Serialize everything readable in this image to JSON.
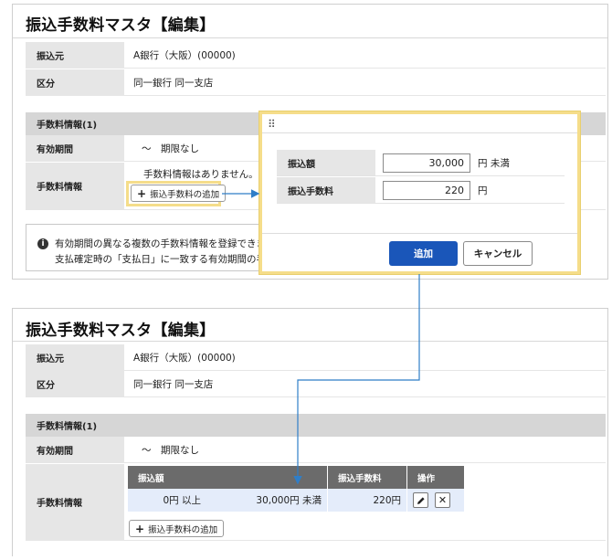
{
  "top": {
    "title": "振込手数料マスタ【編集】",
    "source_label": "振込元",
    "source_value": "A銀行（大阪）(00000)",
    "category_label": "区分",
    "category_value": "同一銀行 同一支店",
    "section_title": "手数料情報(1)",
    "period_label": "有効期間",
    "period_value": "～　期限なし",
    "fee_label": "手数料情報",
    "no_info": "手数料情報はありません。",
    "add_fee_button": "振込手数料の追加",
    "info_line1": "有効期間の異なる複数の手数料情報を登録できま",
    "info_line2": "支払確定時の「支払日」に一致する有効期間の手"
  },
  "modal": {
    "drag_icon": "drag-handle-icon",
    "amount_label": "振込額",
    "amount_value": "30,000",
    "amount_unit": "円 未満",
    "fee_label": "振込手数料",
    "fee_value": "220",
    "fee_unit": "円",
    "add_button": "追加",
    "cancel_button": "キャンセル"
  },
  "bottom": {
    "title": "振込手数料マスタ【編集】",
    "source_label": "振込元",
    "source_value": "A銀行（大阪）(00000)",
    "category_label": "区分",
    "category_value": "同一銀行 同一支店",
    "section_title": "手数料情報(1)",
    "period_label": "有効期間",
    "period_value": "～　期限なし",
    "fee_label": "手数料情報",
    "table": {
      "headers": [
        "振込額",
        "振込手数料",
        "操作"
      ],
      "rows": [
        {
          "amount_from": "0円 以上",
          "amount_to": "30,000円 未満",
          "fee": "220円"
        }
      ]
    },
    "add_fee_button": "振込手数料の追加"
  },
  "colors": {
    "highlight": "#f5dd8a",
    "primary_button": "#1a56b9",
    "connector": "#2f7ec8",
    "table_header": "#6b6b6b",
    "row_highlight": "#e4ecfa"
  }
}
